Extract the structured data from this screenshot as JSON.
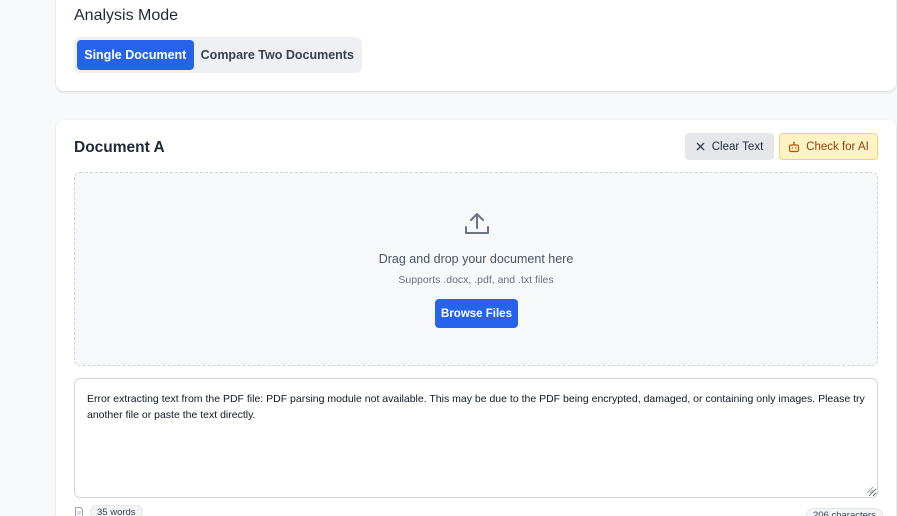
{
  "analysis_mode": {
    "title": "Analysis Mode",
    "options": [
      "Single Document",
      "Compare Two Documents"
    ],
    "selected": "Single Document"
  },
  "document_a": {
    "title": "Document A",
    "clear_label": "Clear Text",
    "check_ai_label": "Check for AI",
    "dropzone": {
      "main_text": "Drag and drop your document here",
      "sub_text": "Supports .docx, .pdf, and .txt files",
      "browse_label": "Browse Files"
    },
    "text_value": "Error extracting text from the PDF file: PDF parsing module not available. This may be due to the PDF being encrypted, damaged, or containing only images. Please try another file or paste the text directly.",
    "word_count": "35 words",
    "char_count": "206 characters"
  },
  "icons": {
    "clear": "close-icon",
    "check_ai": "robot-icon",
    "upload": "upload-icon",
    "words": "document-icon"
  },
  "colors": {
    "primary": "#2563eb",
    "ai_bg": "#fdf3c4",
    "ai_text": "#92400e"
  }
}
